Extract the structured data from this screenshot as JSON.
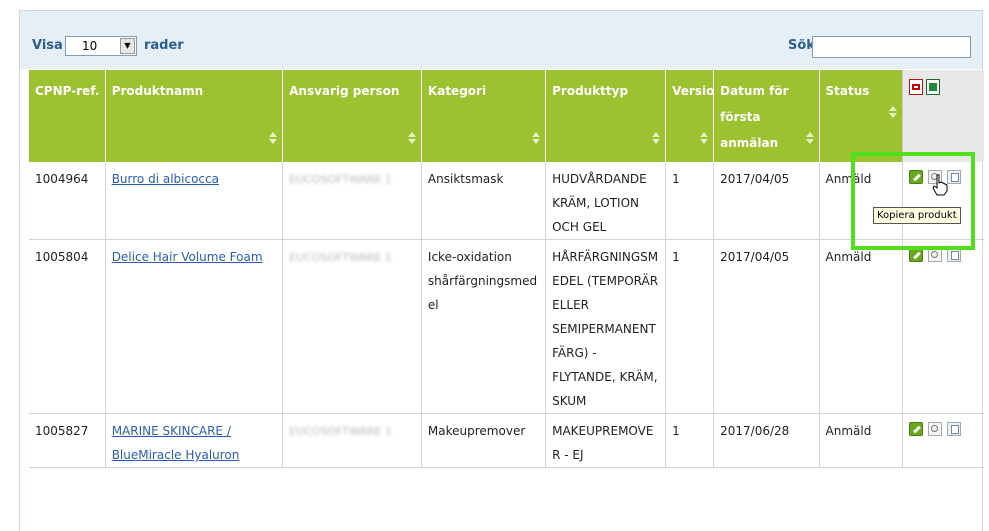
{
  "controls": {
    "show_label": "Visa",
    "length_value": "10",
    "rows_label": "rader",
    "search_label": "Sök:",
    "search_value": ""
  },
  "columns": [
    {
      "label": "CPNP-ref."
    },
    {
      "label": "Produktnamn"
    },
    {
      "label": "Ansvarig person"
    },
    {
      "label": "Kategori"
    },
    {
      "label": "Produkttyp"
    },
    {
      "label": "Version"
    },
    {
      "label": "Datum för första anmälan"
    },
    {
      "label": "Status"
    }
  ],
  "rows": [
    {
      "ref": "1004964",
      "name": "Burro di albicocca",
      "person": "EUCOSOFTWARE 1",
      "category": "Ansiktsmask",
      "type": "HUDVÅRDANDE KRÄM, LOTION OCH GEL",
      "version": "1",
      "date": "2017/04/05",
      "status": "Anmäld"
    },
    {
      "ref": "1005804",
      "name": "Delice Hair Volume Foam",
      "person": "EUCOSOFTWARE 1",
      "category": "Icke-oxidation shårfärgningsmedel",
      "type": "HÅRFÄRGNINGSMEDEL (TEMPORÄR ELLER SEMIPERMANENT FÄRG) - FLYTANDE, KRÄM, SKUM",
      "version": "1",
      "date": "2017/04/05",
      "status": "Anmäld"
    },
    {
      "ref": "1005827",
      "name": "MARINE SKINCARE / BlueMiracle Hyaluron",
      "person": "EUCOSOFTWARE 1",
      "category": "Makeupremover",
      "type": "MAKEUPREMOVER - EJ",
      "version": "1",
      "date": "2017/06/28",
      "status": "Anmäld"
    }
  ],
  "tooltip": "Kopiera produkt",
  "icons": {
    "export_pdf": "pdf-icon",
    "export_excel": "excel-icon",
    "edit": "edit-icon",
    "view": "view-icon",
    "copy": "copy-icon"
  },
  "colors": {
    "header_bg": "#9dc230",
    "highlight": "#4ee01a",
    "link": "#2a5db0",
    "toolbar_bg": "#e6eef6"
  }
}
